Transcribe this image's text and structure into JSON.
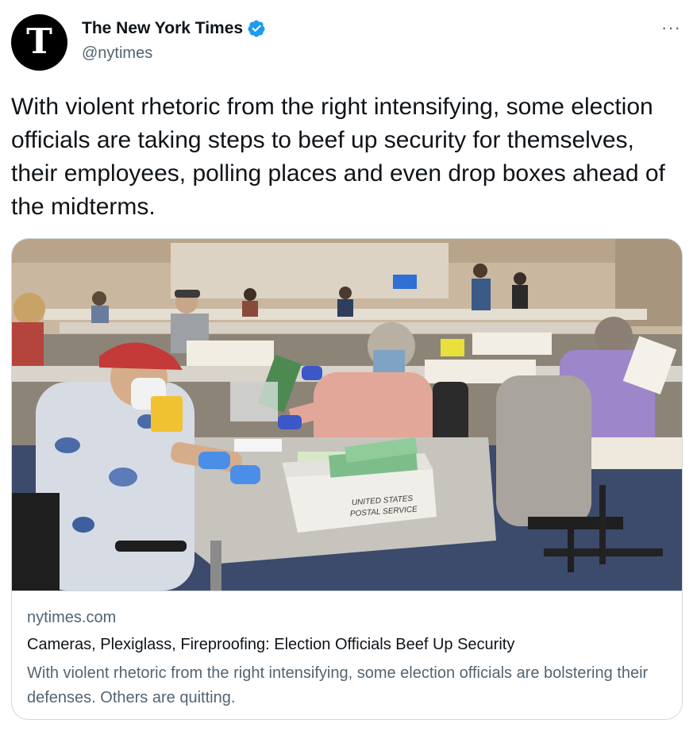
{
  "tweet": {
    "author": {
      "display_name": "The New York Times",
      "handle": "@nytimes",
      "avatar_glyph": "T",
      "verified": true,
      "verified_color": "#1d9bf0"
    },
    "more_label": "···",
    "text": "With violent rhetoric from the right intensifying, some election officials are taking steps to beef up security for themselves, their employees, polling places and even drop boxes ahead of the midterms."
  },
  "card": {
    "image_alt": "Election workers sorting ballots at tables in a large counting room",
    "box_text_line1": "UNITED STATES",
    "box_text_line2": "POSTAL SERVICE",
    "domain": "nytimes.com",
    "title": "Cameras, Plexiglass, Fireproofing: Election Officials Beef Up Security",
    "description": "With violent rhetoric from the right intensifying, some election officials are bolstering their defenses. Others are quitting."
  },
  "icons": {
    "verified": "verified-badge-icon",
    "more": "more-options-icon"
  }
}
